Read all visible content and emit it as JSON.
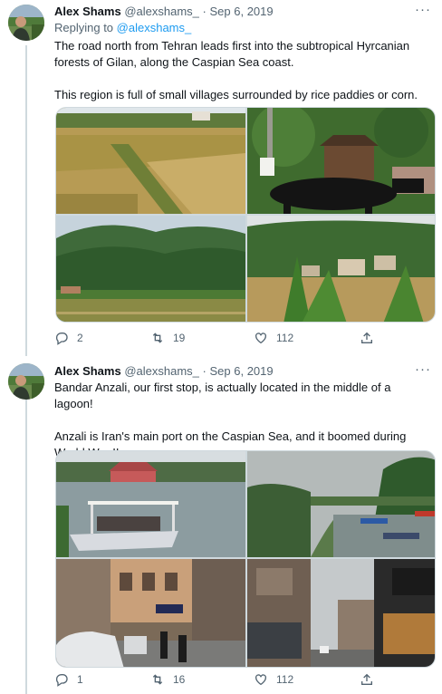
{
  "tweets": [
    {
      "author_name": "Alex Shams",
      "author_handle": "@alexshams_",
      "separator": "·",
      "date": "Sep 6, 2019",
      "more_label": "···",
      "replying_prefix": "Replying to",
      "replying_to": "@alexshams_",
      "paragraphs": [
        "The road north from Tehran leads first into the subtropical Hyrcanian forests of Gilan, along the Caspian Sea coast.",
        "This region is full of small villages surrounded by rice paddies or corn."
      ],
      "replies": "2",
      "retweets": "19",
      "likes": "112",
      "images": [
        "rice-paddy-photo",
        "cow-barn-photo",
        "forest-hills-photo",
        "village-corn-photo"
      ]
    },
    {
      "author_name": "Alex Shams",
      "author_handle": "@alexshams_",
      "separator": "·",
      "date": "Sep 6, 2019",
      "more_label": "···",
      "paragraphs": [
        "Bandar Anzali, our first stop, is actually located in the middle of a lagoon!",
        "Anzali is Iran's main port on the Caspian Sea, and it boomed during World War II."
      ],
      "replies": "1",
      "retweets": "16",
      "likes": "112",
      "images": [
        "lagoon-ferry-photo",
        "lagoon-boats-photo",
        "street-cars-photo",
        "street-shops-photo"
      ]
    }
  ],
  "icons": {
    "reply": "reply-icon",
    "retweet": "retweet-icon",
    "like": "heart-icon",
    "share": "share-icon"
  },
  "colors": {
    "text": "#0f1419",
    "secondary": "#536471",
    "link": "#1d9bf0",
    "divider": "#cfd9de"
  }
}
